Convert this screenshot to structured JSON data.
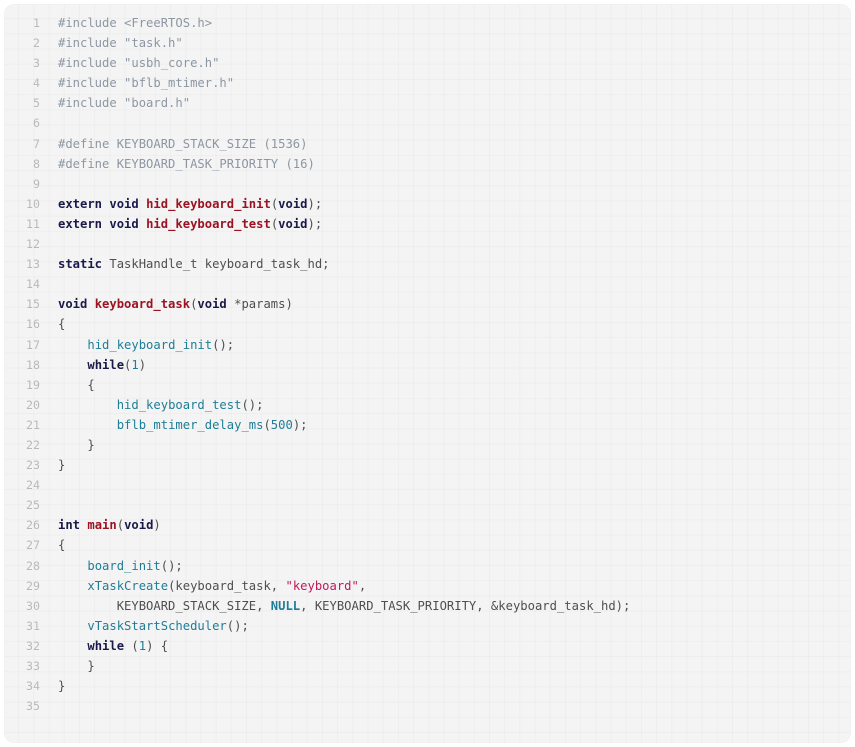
{
  "editor": {
    "language": "C",
    "first_line": 1,
    "last_line": 35,
    "total_lines": 35,
    "background_color": "#f4f4f4",
    "gutter_color": "#b9b9b9",
    "default_text_color": "#4f4f4f"
  },
  "theme": {
    "preprocessor": "#8d97a3",
    "keyword": "#1a1a4a",
    "definition": "#9b1322",
    "call": "#1f7d96",
    "string": "#c2185b",
    "number": "#1f7d96",
    "constant": "#1f7d96",
    "plain": "#4f4f4f"
  },
  "lines": [
    {
      "n": "1",
      "tokens": [
        {
          "t": "#include <FreeRTOS.h>",
          "c": "tok-pre"
        }
      ]
    },
    {
      "n": "2",
      "tokens": [
        {
          "t": "#include \"task.h\"",
          "c": "tok-pre"
        }
      ]
    },
    {
      "n": "3",
      "tokens": [
        {
          "t": "#include \"usbh_core.h\"",
          "c": "tok-pre"
        }
      ]
    },
    {
      "n": "4",
      "tokens": [
        {
          "t": "#include \"bflb_mtimer.h\"",
          "c": "tok-pre"
        }
      ]
    },
    {
      "n": "5",
      "tokens": [
        {
          "t": "#include \"board.h\"",
          "c": "tok-pre"
        }
      ]
    },
    {
      "n": "6",
      "tokens": []
    },
    {
      "n": "7",
      "tokens": [
        {
          "t": "#define KEYBOARD_STACK_SIZE (1536)",
          "c": "tok-pre"
        }
      ]
    },
    {
      "n": "8",
      "tokens": [
        {
          "t": "#define KEYBOARD_TASK_PRIORITY (16)",
          "c": "tok-pre"
        }
      ]
    },
    {
      "n": "9",
      "tokens": []
    },
    {
      "n": "10",
      "tokens": [
        {
          "t": "extern void ",
          "c": "tok-kw"
        },
        {
          "t": "hid_keyboard_init",
          "c": "tok-def"
        },
        {
          "t": "(",
          "c": "tok-plain"
        },
        {
          "t": "void",
          "c": "tok-kw"
        },
        {
          "t": ");",
          "c": "tok-plain"
        }
      ]
    },
    {
      "n": "11",
      "tokens": [
        {
          "t": "extern void ",
          "c": "tok-kw"
        },
        {
          "t": "hid_keyboard_test",
          "c": "tok-def"
        },
        {
          "t": "(",
          "c": "tok-plain"
        },
        {
          "t": "void",
          "c": "tok-kw"
        },
        {
          "t": ");",
          "c": "tok-plain"
        }
      ]
    },
    {
      "n": "12",
      "tokens": []
    },
    {
      "n": "13",
      "tokens": [
        {
          "t": "static",
          "c": "tok-kw"
        },
        {
          "t": " TaskHandle_t keyboard_task_hd;",
          "c": "tok-plain"
        }
      ]
    },
    {
      "n": "14",
      "tokens": []
    },
    {
      "n": "15",
      "tokens": [
        {
          "t": "void ",
          "c": "tok-kw"
        },
        {
          "t": "keyboard_task",
          "c": "tok-def"
        },
        {
          "t": "(",
          "c": "tok-plain"
        },
        {
          "t": "void",
          "c": "tok-kw"
        },
        {
          "t": " *params)",
          "c": "tok-plain"
        }
      ]
    },
    {
      "n": "16",
      "tokens": [
        {
          "t": "{",
          "c": "tok-plain"
        }
      ]
    },
    {
      "n": "17",
      "tokens": [
        {
          "t": "    ",
          "c": "tok-plain"
        },
        {
          "t": "hid_keyboard_init",
          "c": "tok-call"
        },
        {
          "t": "();",
          "c": "tok-plain"
        }
      ]
    },
    {
      "n": "18",
      "tokens": [
        {
          "t": "    ",
          "c": "tok-plain"
        },
        {
          "t": "while",
          "c": "tok-kw"
        },
        {
          "t": "(",
          "c": "tok-plain"
        },
        {
          "t": "1",
          "c": "tok-num"
        },
        {
          "t": ")",
          "c": "tok-plain"
        }
      ]
    },
    {
      "n": "19",
      "tokens": [
        {
          "t": "    {",
          "c": "tok-plain"
        }
      ]
    },
    {
      "n": "20",
      "tokens": [
        {
          "t": "        ",
          "c": "tok-plain"
        },
        {
          "t": "hid_keyboard_test",
          "c": "tok-call"
        },
        {
          "t": "();",
          "c": "tok-plain"
        }
      ]
    },
    {
      "n": "21",
      "tokens": [
        {
          "t": "        ",
          "c": "tok-plain"
        },
        {
          "t": "bflb_mtimer_delay_ms",
          "c": "tok-call"
        },
        {
          "t": "(",
          "c": "tok-plain"
        },
        {
          "t": "500",
          "c": "tok-num"
        },
        {
          "t": ");",
          "c": "tok-plain"
        }
      ]
    },
    {
      "n": "22",
      "tokens": [
        {
          "t": "    }",
          "c": "tok-plain"
        }
      ]
    },
    {
      "n": "23",
      "tokens": [
        {
          "t": "}",
          "c": "tok-plain"
        }
      ]
    },
    {
      "n": "24",
      "tokens": []
    },
    {
      "n": "25",
      "tokens": []
    },
    {
      "n": "26",
      "tokens": [
        {
          "t": "int ",
          "c": "tok-kw"
        },
        {
          "t": "main",
          "c": "tok-def"
        },
        {
          "t": "(",
          "c": "tok-plain"
        },
        {
          "t": "void",
          "c": "tok-kw"
        },
        {
          "t": ")",
          "c": "tok-plain"
        }
      ]
    },
    {
      "n": "27",
      "tokens": [
        {
          "t": "{",
          "c": "tok-plain"
        }
      ]
    },
    {
      "n": "28",
      "tokens": [
        {
          "t": "    ",
          "c": "tok-plain"
        },
        {
          "t": "board_init",
          "c": "tok-call"
        },
        {
          "t": "();",
          "c": "tok-plain"
        }
      ]
    },
    {
      "n": "29",
      "tokens": [
        {
          "t": "    ",
          "c": "tok-plain"
        },
        {
          "t": "xTaskCreate",
          "c": "tok-call"
        },
        {
          "t": "(keyboard_task, ",
          "c": "tok-plain"
        },
        {
          "t": "\"keyboard\"",
          "c": "tok-str"
        },
        {
          "t": ",",
          "c": "tok-plain"
        }
      ]
    },
    {
      "n": "30",
      "tokens": [
        {
          "t": "        KEYBOARD_STACK_SIZE, ",
          "c": "tok-plain"
        },
        {
          "t": "NULL",
          "c": "tok-const"
        },
        {
          "t": ", KEYBOARD_TASK_PRIORITY, &keyboard_task_hd);",
          "c": "tok-plain"
        }
      ]
    },
    {
      "n": "31",
      "tokens": [
        {
          "t": "    ",
          "c": "tok-plain"
        },
        {
          "t": "vTaskStartScheduler",
          "c": "tok-call"
        },
        {
          "t": "();",
          "c": "tok-plain"
        }
      ]
    },
    {
      "n": "32",
      "tokens": [
        {
          "t": "    ",
          "c": "tok-plain"
        },
        {
          "t": "while",
          "c": "tok-kw"
        },
        {
          "t": " (",
          "c": "tok-plain"
        },
        {
          "t": "1",
          "c": "tok-num"
        },
        {
          "t": ") {",
          "c": "tok-plain"
        }
      ]
    },
    {
      "n": "33",
      "tokens": [
        {
          "t": "    }",
          "c": "tok-plain"
        }
      ]
    },
    {
      "n": "34",
      "tokens": [
        {
          "t": "}",
          "c": "tok-plain"
        }
      ]
    },
    {
      "n": "35",
      "tokens": []
    }
  ]
}
